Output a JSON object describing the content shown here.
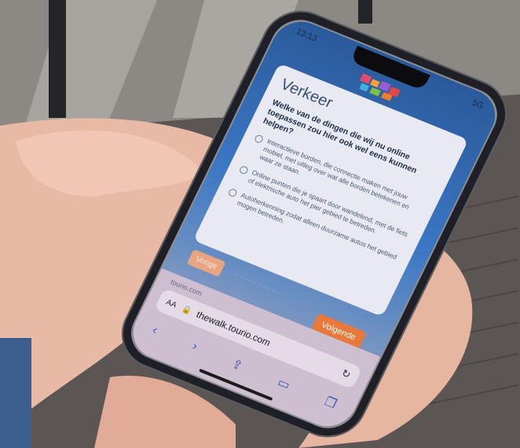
{
  "status_bar": {
    "time": "13:13",
    "signal": "5G"
  },
  "quiz": {
    "title": "Verkeer",
    "question": "Welke van de dingen die wij nu online toepassen zou hier ook wel eens kunnen helpen?",
    "options": [
      "Interactieve borden, die connectie maken met jouw mobiel, met uitleg over wat alle borden betekenen en waar ze staan.",
      "Online punten die je spaart door wandelend, met de fiets of elektrische auto het pier gebied te betreden.",
      "Autoherkenning zodat alleen duurzame autos het gebied mogen betreden."
    ],
    "prev_label": "Vorige",
    "next_label": "Volgende"
  },
  "browser": {
    "tab_host": "tourio.com",
    "aa_label": "AA",
    "url": "thewalk.tourio.com"
  },
  "icons": {
    "lock": "lock-icon",
    "reload": "reload-icon",
    "back": "back-icon",
    "forward": "forward-icon",
    "share": "share-icon",
    "bookmarks": "bookmarks-icon",
    "tabs": "tabs-icon"
  },
  "colors": {
    "next_button": "#e8793a",
    "screen_blue": "#3b77c4"
  }
}
